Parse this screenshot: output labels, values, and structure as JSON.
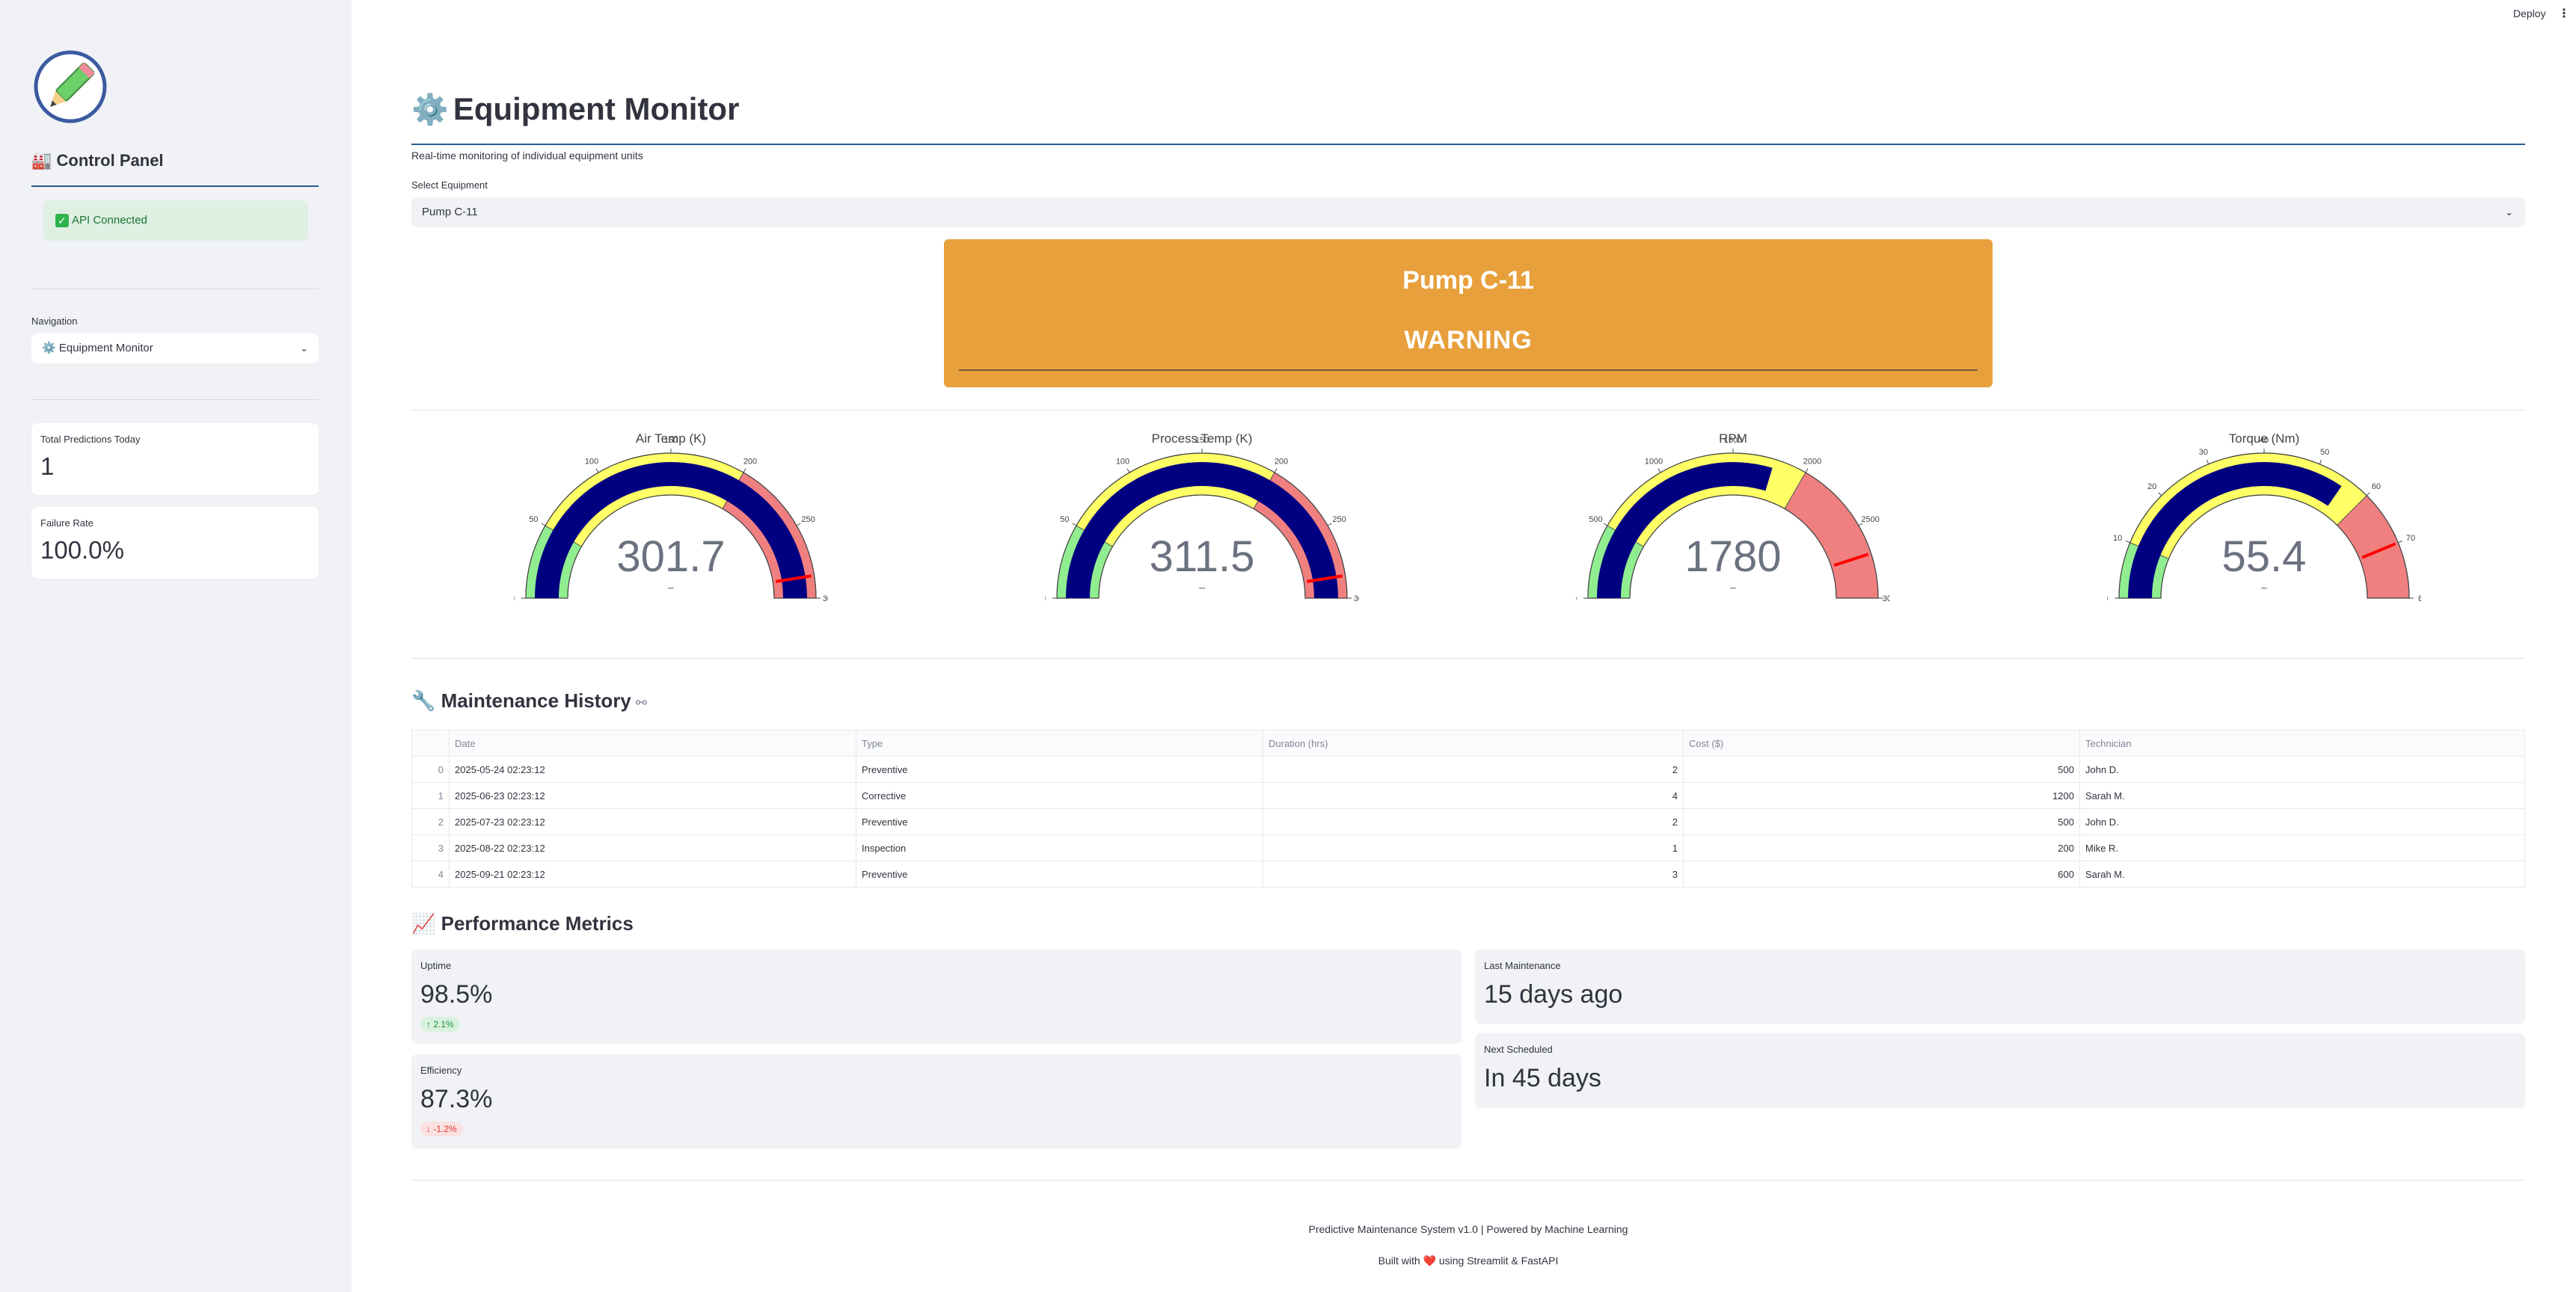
{
  "sidebar": {
    "title": "Control Panel",
    "api_status": "API Connected",
    "nav_label": "Navigation",
    "nav_value": "Equipment Monitor",
    "metrics": [
      {
        "label": "Total Predictions Today",
        "value": "1"
      },
      {
        "label": "Failure Rate",
        "value": "100.0%"
      }
    ]
  },
  "topbar": {
    "deploy": "Deploy",
    "menu": "⋮"
  },
  "main": {
    "title": "Equipment Monitor",
    "subtitle": "Real-time monitoring of individual equipment units",
    "select_label": "Select Equipment",
    "select_value": "Pump C-11",
    "status": {
      "name": "Pump C-11",
      "state": "WARNING",
      "color": "#e8a03c"
    }
  },
  "gauges": [
    {
      "title": "Air Temp (K)",
      "value": 301.7,
      "display": "301.7",
      "suffix": "−",
      "min": 0,
      "max": 300,
      "steps": [
        [
          0,
          50,
          "#90ee90"
        ],
        [
          50,
          200,
          "#ffff66"
        ],
        [
          200,
          300,
          "#f08080"
        ]
      ],
      "threshold": 285,
      "ticks": [
        "0",
        "50",
        "100",
        "150",
        "200",
        "250",
        "300"
      ],
      "tick_vals": [
        0,
        50,
        100,
        150,
        200,
        250,
        300
      ]
    },
    {
      "title": "Process Temp (K)",
      "value": 311.5,
      "display": "311.5",
      "suffix": "−",
      "min": 0,
      "max": 300,
      "steps": [
        [
          0,
          50,
          "#90ee90"
        ],
        [
          50,
          200,
          "#ffff66"
        ],
        [
          200,
          300,
          "#f08080"
        ]
      ],
      "threshold": 285,
      "ticks": [
        "0",
        "50",
        "100",
        "150",
        "200",
        "250",
        "300"
      ],
      "tick_vals": [
        0,
        50,
        100,
        150,
        200,
        250,
        300
      ]
    },
    {
      "title": "RPM",
      "value": 1780,
      "display": "1780",
      "suffix": "−",
      "min": 0,
      "max": 3000,
      "steps": [
        [
          0,
          500,
          "#90ee90"
        ],
        [
          500,
          2000,
          "#ffff66"
        ],
        [
          2000,
          3000,
          "#f08080"
        ]
      ],
      "threshold": 2700,
      "ticks": [
        "0",
        "500",
        "1000",
        "1500",
        "2000",
        "2500",
        "3000"
      ],
      "tick_vals": [
        0,
        500,
        1000,
        1500,
        2000,
        2500,
        3000
      ]
    },
    {
      "title": "Torque (Nm)",
      "value": 55.4,
      "display": "55.4",
      "suffix": "−",
      "min": 0,
      "max": 80,
      "steps": [
        [
          0,
          10,
          "#90ee90"
        ],
        [
          10,
          60,
          "#ffff66"
        ],
        [
          60,
          80,
          "#f08080"
        ]
      ],
      "threshold": 70,
      "ticks": [
        "0",
        "10",
        "20",
        "30",
        "40",
        "50",
        "60",
        "70",
        "80"
      ],
      "tick_vals": [
        0,
        10,
        20,
        30,
        40,
        50,
        60,
        70,
        80
      ]
    }
  ],
  "history": {
    "title": "Maintenance History",
    "columns": [
      "",
      "Date",
      "Type",
      "Duration (hrs)",
      "Cost ($)",
      "Technician"
    ],
    "rows": [
      [
        "0",
        "2025-05-24 02:23:12",
        "Preventive",
        "2",
        "500",
        "John D."
      ],
      [
        "1",
        "2025-06-23 02:23:12",
        "Corrective",
        "4",
        "1200",
        "Sarah M."
      ],
      [
        "2",
        "2025-07-23 02:23:12",
        "Preventive",
        "2",
        "500",
        "John D."
      ],
      [
        "3",
        "2025-08-22 02:23:12",
        "Inspection",
        "1",
        "200",
        "Mike R."
      ],
      [
        "4",
        "2025-09-21 02:23:12",
        "Preventive",
        "3",
        "600",
        "Sarah M."
      ]
    ]
  },
  "performance": {
    "title": "Performance Metrics",
    "uptime": {
      "label": "Uptime",
      "value": "98.5%",
      "delta": "2.1%"
    },
    "efficiency": {
      "label": "Efficiency",
      "value": "87.3%",
      "delta": "-1.2%"
    },
    "last_maintenance": {
      "label": "Last Maintenance",
      "value": "15 days ago"
    },
    "next_scheduled": {
      "label": "Next Scheduled",
      "value": "In 45 days"
    }
  },
  "footer": {
    "line1": "Predictive Maintenance System v1.0 | Powered by Machine Learning",
    "line2_prefix": "Built with",
    "line2_suffix": "using Streamlit & FastAPI"
  }
}
